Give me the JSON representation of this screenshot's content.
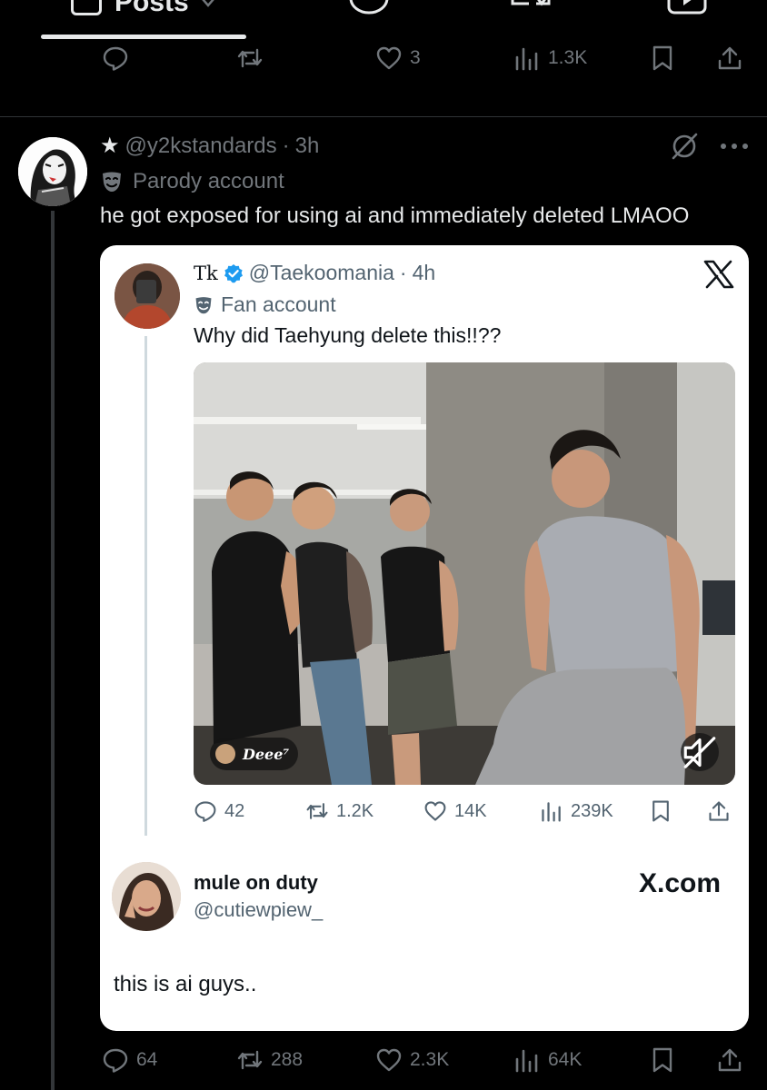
{
  "tabs": {
    "active_label": "Posts"
  },
  "prev_post": {
    "actions": {
      "replies": "",
      "reposts": "",
      "likes": "3",
      "views": "1.3K"
    }
  },
  "post": {
    "handle": "@y2kstandards",
    "sep": "·",
    "time": "3h",
    "badge_label": "Parody account",
    "text": "he got exposed for using ai and immediately deleted LMAOO",
    "actions": {
      "replies": "64",
      "reposts": "288",
      "likes": "2.3K",
      "views": "64K"
    }
  },
  "quoted": {
    "name": "Tk",
    "handle": "@Taekoomania",
    "sep": "·",
    "time": "4h",
    "badge_label": "Fan account",
    "text": "Why did Taehyung delete this!!??",
    "watermark": "Deee⁷",
    "actions": {
      "replies": "42",
      "reposts": "1.2K",
      "likes": "14K",
      "views": "239K"
    }
  },
  "reply": {
    "name": "mule on duty",
    "handle": "@cutiewpiew_",
    "brand": "X.com",
    "text": "this is ai guys.."
  },
  "colors": {
    "background": "#000000",
    "text": "#e7e9ea",
    "muted": "#71767b",
    "verified": "#1d9bf0",
    "card": "#ffffff"
  }
}
